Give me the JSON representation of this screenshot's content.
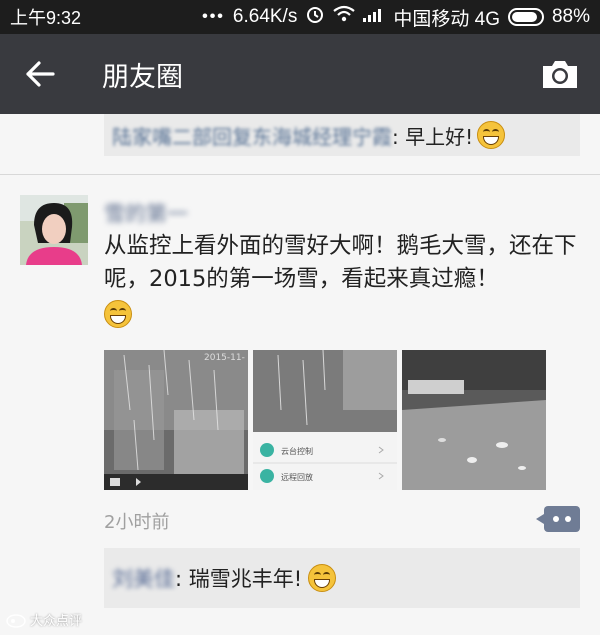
{
  "statusbar": {
    "time": "上午9:32",
    "speed": "6.64K/s",
    "carrier": "中国移动 4G",
    "battery": "88%",
    "battery_level": 0.88
  },
  "navbar": {
    "title": "朋友圈",
    "icons": [
      "back-arrow-icon",
      "camera-icon"
    ]
  },
  "prev_comment": {
    "author_line": "陆家嘴二部回复东海城经理宁霞",
    "text": ": 早上好!"
  },
  "post": {
    "author": "雪的第一",
    "text": "从监控上看外面的雪好大啊！鹅毛大雪，还在下呢，2015的第一场雪，看起来真过瘾！",
    "time_ago": "2小时前",
    "photo1_stamp": "2015-11-",
    "photo2_menu": [
      "云台控制",
      "远程回放"
    ]
  },
  "comment": {
    "author": "刘美佳",
    "text": ": 瑞雪兆丰年!"
  },
  "watermark": "大众点评",
  "colors": {
    "navbar": "#393a3f",
    "statusbar": "#1d1d1d",
    "name_link": "#576b95"
  }
}
